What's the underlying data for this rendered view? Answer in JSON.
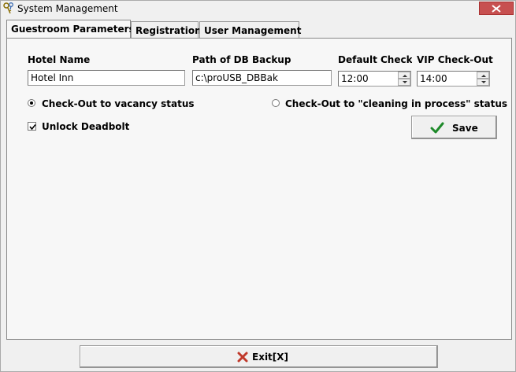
{
  "window": {
    "title": "System Management",
    "icon": "keys-icon"
  },
  "tabs": [
    {
      "label": "Guestroom Parameters",
      "active": true
    },
    {
      "label": "Registration",
      "active": false
    },
    {
      "label": "User Management",
      "active": false
    }
  ],
  "form": {
    "hotel_name_label": "Hotel Name",
    "hotel_name_value": "Hotel Inn",
    "db_backup_label": "Path of DB Backup",
    "db_backup_value": "c:\\proUSB_DBBak",
    "default_checkout_label": "Default Check-Out",
    "default_checkout_value": "12:00",
    "vip_checkout_label": "VIP Check-Out",
    "vip_checkout_value": "14:00",
    "radio_vacancy_label": "Check-Out to vacancy status",
    "radio_vacancy_selected": true,
    "radio_cleaning_label": "Check-Out to \"cleaning in process\" status",
    "radio_cleaning_selected": false,
    "unlock_deadbolt_label": "Unlock Deadbolt",
    "unlock_deadbolt_checked": true
  },
  "buttons": {
    "save_label": "Save",
    "exit_label": "Exit[X]"
  },
  "colors": {
    "save_check": "#1e8a2a",
    "exit_x": "#c0392b",
    "close_button": "#c75050"
  }
}
